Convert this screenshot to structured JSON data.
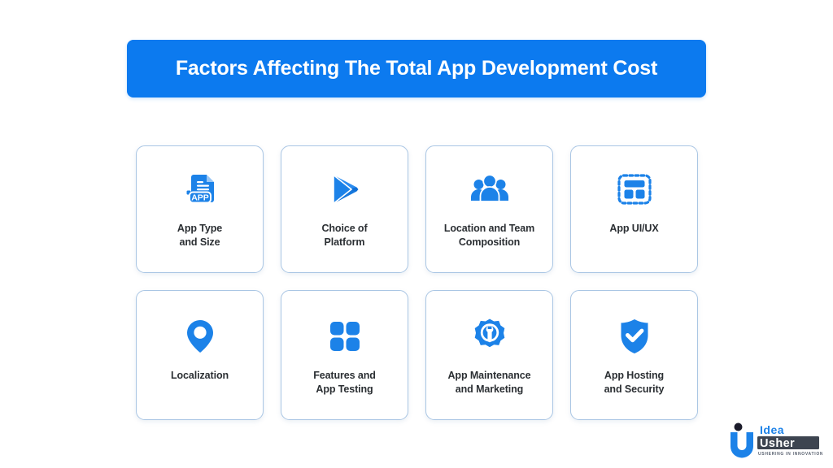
{
  "header": {
    "title": "Factors Affecting The Total App Development Cost",
    "banner_color": "#0c7aef",
    "title_color": "#ffffff"
  },
  "theme": {
    "background": "#ffffff",
    "accent_blue": "#0c7aef",
    "card_border": "#aac6e4",
    "label_color": "#2b2f33"
  },
  "cards": [
    {
      "icon": "app-document-icon",
      "label": "App Type\nand Size"
    },
    {
      "icon": "play-store-icon",
      "label": "Choice of\nPlatform"
    },
    {
      "icon": "team-group-icon",
      "label": "Location and Team\nComposition"
    },
    {
      "icon": "wireframe-layout-icon",
      "label": "App UI/UX"
    },
    {
      "icon": "map-pin-icon",
      "label": "Localization"
    },
    {
      "icon": "grid-squares-icon",
      "label": "Features and\nApp Testing"
    },
    {
      "icon": "gear-wrench-icon",
      "label": "App Maintenance\nand Marketing"
    },
    {
      "icon": "shield-check-icon",
      "label": "App Hosting\nand Security"
    }
  ],
  "logo": {
    "name_part1": "Idea",
    "name_part2": "Usher",
    "tagline": "USHERING IN INNOVATION",
    "mark_letter": "U"
  }
}
